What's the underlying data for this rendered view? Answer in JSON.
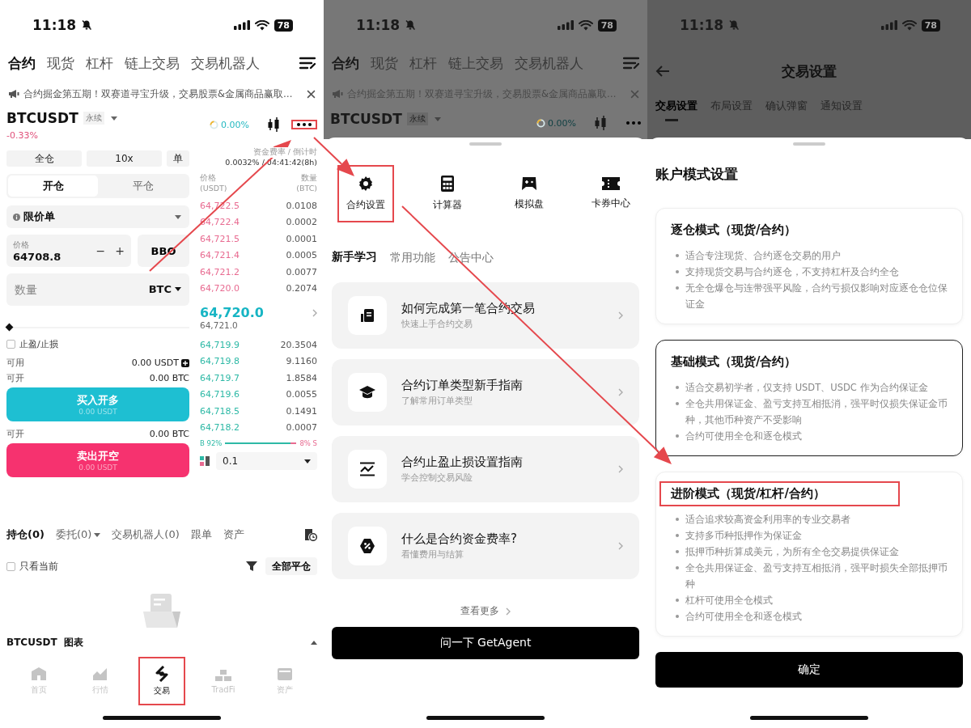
{
  "trade_screen": {
    "status_bar": {
      "time": "11:18",
      "battery": "78"
    },
    "top_tabs": [
      {
        "label": "合约",
        "selected": true
      },
      {
        "label": "现货",
        "selected": false
      },
      {
        "label": "杠杆",
        "selected": false
      },
      {
        "label": "链上交易",
        "selected": false
      },
      {
        "label": "交易机器人",
        "selected": false
      }
    ],
    "announcement": "合约掘金第五期！双赛道寻宝升级，交易股票&金属商品赢取…",
    "symbol": {
      "name": "BTCUSDT",
      "type": "永续",
      "change": "-0.33%",
      "funding_rate": "0.00%",
      "more_highlighted": true
    },
    "order_form": {
      "margin_mode": "全仓",
      "leverage": "10x",
      "position_mode": "单",
      "sides": [
        {
          "label": "开仓",
          "selected": true
        },
        {
          "label": "平仓",
          "selected": false
        }
      ],
      "order_type": "限价单",
      "price": {
        "label": "价格",
        "value": "64708.8",
        "minus": "−",
        "plus": "+"
      },
      "bbo": "BBO",
      "quantity": {
        "placeholder": "数量",
        "unit": "BTC"
      },
      "slider": {
        "level": 0
      },
      "tp_sl": {
        "label": "止盈/止损",
        "checked": false
      },
      "available": {
        "label": "可用",
        "value": "0.00 USDT"
      },
      "buy_max": {
        "label": "可开",
        "value": "0.00 BTC"
      },
      "buy_button": {
        "label": "买入开多",
        "amount": "0.00 USDT"
      },
      "sell_max": {
        "label": "可开",
        "value": "0.00 BTC"
      },
      "sell_button": {
        "label": "卖出开空",
        "amount": "0.00 USDT"
      }
    },
    "order_book": {
      "funding_label": "资金费率 / 倒计时",
      "funding_value": "0.0032% / 04:41:42(8h)",
      "price_label": "价格",
      "price_unit": "(USDT)",
      "amount_label": "数量",
      "amount_unit": "(BTC)",
      "asks": [
        {
          "price": "64,722.5",
          "amount": "0.0108"
        },
        {
          "price": "64,722.4",
          "amount": "0.0002"
        },
        {
          "price": "64,721.5",
          "amount": "0.0001"
        },
        {
          "price": "64,721.4",
          "amount": "0.0005"
        },
        {
          "price": "64,721.2",
          "amount": "0.0077"
        },
        {
          "price": "64,720.0",
          "amount": "0.2074"
        }
      ],
      "last_price": "64,720.0",
      "mark_price": "64,721.0",
      "bids": [
        {
          "price": "64,719.9",
          "amount": "20.3504"
        },
        {
          "price": "64,719.8",
          "amount": "9.1160"
        },
        {
          "price": "64,719.7",
          "amount": "1.8584"
        },
        {
          "price": "64,719.6",
          "amount": "0.0055"
        },
        {
          "price": "64,718.5",
          "amount": "0.1491"
        },
        {
          "price": "64,718.2",
          "amount": "0.0007"
        }
      ],
      "buy_ratio": "B 92%",
      "sell_ratio": "8% S",
      "level": 0.92,
      "precision": "0.1"
    },
    "position_tabs": [
      {
        "label": "持仓(0)",
        "selected": true
      },
      {
        "label": "委托(0)",
        "selected": false
      },
      {
        "label": "交易机器人(0)",
        "selected": false
      },
      {
        "label": "跟单",
        "selected": false
      },
      {
        "label": "资产",
        "selected": false
      }
    ],
    "only_current": {
      "label": "只看当前",
      "checked": false
    },
    "close_all": "全部平仓",
    "chart_bar": {
      "symbol": "BTCUSDT",
      "label": "图表"
    },
    "nav": [
      {
        "label": "首页",
        "selected": false,
        "highlighted": false
      },
      {
        "label": "行情",
        "selected": false,
        "highlighted": false
      },
      {
        "label": "交易",
        "selected": true,
        "highlighted": true
      },
      {
        "label": "TradFi",
        "selected": false,
        "highlighted": false
      },
      {
        "label": "资产",
        "selected": false,
        "highlighted": false
      }
    ]
  },
  "tools_screen": {
    "background": {
      "status_bar": {
        "time": "11:18",
        "battery": "78"
      },
      "top_tabs": [
        {
          "label": "合约",
          "selected": true
        },
        {
          "label": "现货",
          "selected": false
        },
        {
          "label": "杠杆",
          "selected": false
        },
        {
          "label": "链上交易",
          "selected": false
        },
        {
          "label": "交易机器人",
          "selected": false
        }
      ],
      "announcement": "合约掘金第五期！双赛道寻宝升级，交易股票&金属商品赢取…",
      "symbol": "BTCUSDT",
      "type": "永续",
      "funding_rate": "0.00%"
    },
    "tools": [
      {
        "label": "合约设置",
        "highlighted": true
      },
      {
        "label": "计算器",
        "highlighted": false
      },
      {
        "label": "模拟盘",
        "highlighted": false
      },
      {
        "label": "卡券中心",
        "highlighted": false
      }
    ],
    "tabs": [
      {
        "label": "新手学习",
        "selected": true
      },
      {
        "label": "常用功能",
        "selected": false
      },
      {
        "label": "公告中心",
        "selected": false
      }
    ],
    "guides": [
      {
        "title": "如何完成第一笔合约交易",
        "subtitle": "快速上手合约交易"
      },
      {
        "title": "合约订单类型新手指南",
        "subtitle": "了解常用订单类型"
      },
      {
        "title": "合约止盈止损设置指南",
        "subtitle": "学会控制交易风险"
      },
      {
        "title": "什么是合约资金费率?",
        "subtitle": "看懂费用与结算"
      }
    ],
    "more": "查看更多",
    "ask_button": "问一下 GetAgent"
  },
  "settings_screen": {
    "background": {
      "status_bar": {
        "time": "11:18",
        "battery": "78"
      },
      "title": "交易设置",
      "tabs": [
        {
          "label": "交易设置",
          "selected": true
        },
        {
          "label": "布局设置",
          "selected": false
        },
        {
          "label": "确认弹窗",
          "selected": false
        },
        {
          "label": "通知设置",
          "selected": false
        }
      ]
    },
    "sheet_title": "账户模式设置",
    "modes": [
      {
        "title": "逐仓模式（现货/合约）",
        "selected": false,
        "highlighted": false,
        "points": [
          "适合专注现货、合约逐仓交易的用户",
          "支持现货交易与合约逐仓，不支持杠杆及合约全仓",
          "无全仓爆仓与连带强平风险，合约亏损仅影响对应逐仓仓位保证金"
        ]
      },
      {
        "title": "基础模式（现货/合约）",
        "selected": true,
        "highlighted": false,
        "points": [
          "适合交易初学者，仅支持 USDT、USDC 作为合约保证金",
          "全仓共用保证金、盈亏支持互相抵消，强平时仅损失保证金币种，其他币种资产不受影响",
          "合约可使用全仓和逐仓模式"
        ]
      },
      {
        "title": "进阶模式（现货/杠杆/合约）",
        "selected": false,
        "highlighted": true,
        "points": [
          "适合追求较高资金利用率的专业交易者",
          "支持多币种抵押作为保证金",
          "抵押币种折算成美元，为所有全仓交易提供保证金",
          "全仓共用保证金、盈亏支持互相抵消，强平时损失全部抵押币种",
          "杠杆可使用全仓模式",
          "合约可使用全仓和逐仓模式"
        ]
      }
    ],
    "confirm": "确定"
  }
}
